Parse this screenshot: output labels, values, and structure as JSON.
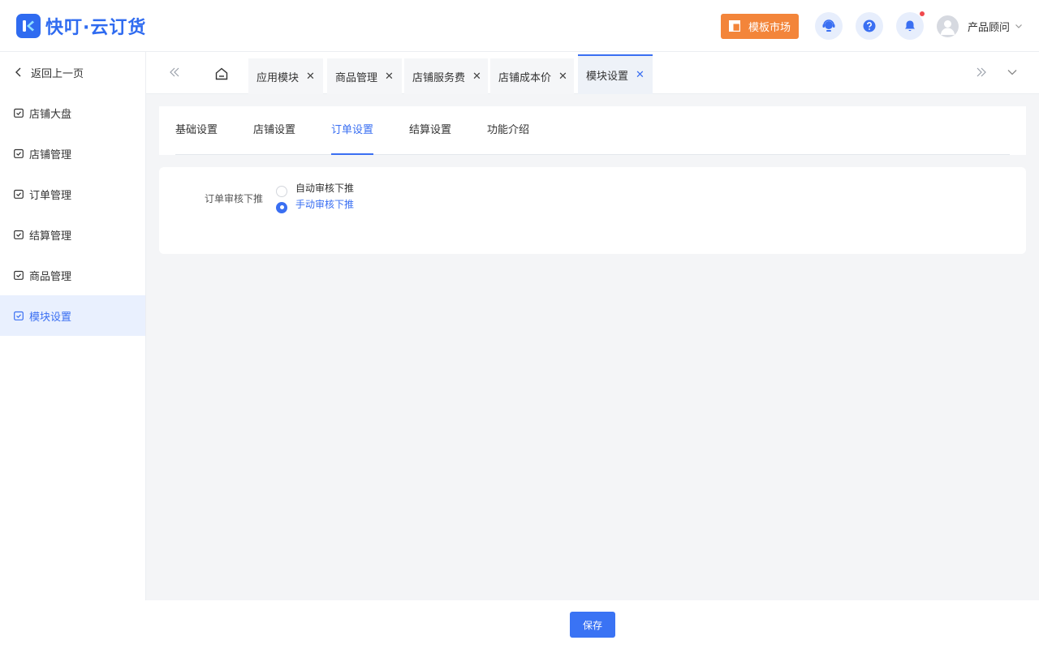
{
  "brand": {
    "name": "快叮·云订货",
    "color": "#2f6bf0"
  },
  "header": {
    "market_label": "模板市场",
    "market_icon": "template-icon",
    "user_name": "产品顾问",
    "icons": [
      "customer-service-icon",
      "help-icon",
      "bell-icon",
      "user-avatar-icon",
      "chevron-down-icon"
    ]
  },
  "sidebar": {
    "back_label": "返回上一页",
    "items": [
      {
        "label": "店铺大盘",
        "active": false
      },
      {
        "label": "店铺管理",
        "active": false
      },
      {
        "label": "订单管理",
        "active": false
      },
      {
        "label": "结算管理",
        "active": false
      },
      {
        "label": "商品管理",
        "active": false
      },
      {
        "label": "模块设置",
        "active": true
      }
    ]
  },
  "tabs": [
    {
      "label": "应用模块",
      "active": false
    },
    {
      "label": "商品管理",
      "active": false
    },
    {
      "label": "店铺服务费",
      "active": false
    },
    {
      "label": "店铺成本价",
      "active": false
    },
    {
      "label": "模块设置",
      "active": true
    }
  ],
  "subtabs": [
    {
      "label": "基础设置",
      "active": false
    },
    {
      "label": "店铺设置",
      "active": false
    },
    {
      "label": "订单设置",
      "active": true
    },
    {
      "label": "结算设置",
      "active": false
    },
    {
      "label": "功能介绍",
      "active": false
    }
  ],
  "form": {
    "label": "订单审核下推",
    "options": [
      {
        "label": "自动审核下推",
        "checked": false
      },
      {
        "label": "手动审核下推",
        "checked": true
      }
    ]
  },
  "footer": {
    "save_label": "保存"
  },
  "colors": {
    "accent": "#3a6ff2",
    "market": "#f3853a",
    "notify_dot": "#f0494d"
  }
}
